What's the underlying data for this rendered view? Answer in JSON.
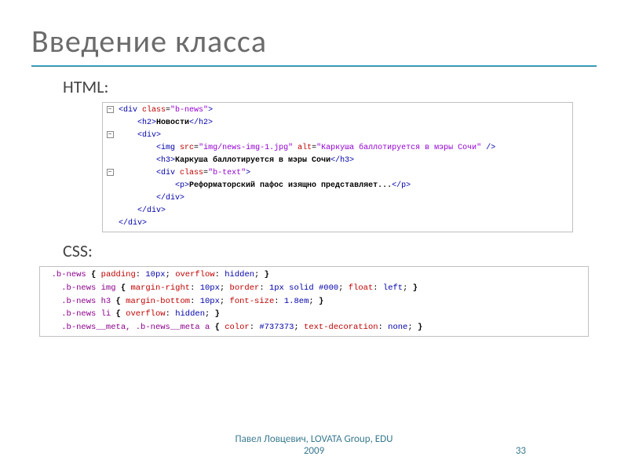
{
  "slide": {
    "title": "Введение класса",
    "section_html": "HTML:",
    "section_css": "CSS:",
    "footer_author": "Павел Ловцевич, LOVATA Group, EDU",
    "footer_year": "2009",
    "page_number": "33"
  },
  "html_code": {
    "l1_open": "<div ",
    "l1_attr": "class",
    "l1_eq": "=",
    "l1_val": "\"b-news\"",
    "l1_close": ">",
    "l2_open": "<h2>",
    "l2_text": "Новости",
    "l2_close": "</h2>",
    "l3": "<div>",
    "l4_open": "<img ",
    "l4_a1": "src",
    "l4_v1": "\"img/news-img-1.jpg\"",
    "l4_a2": "alt",
    "l4_v2": "\"Каркуша баллотируется в мэры Сочи\"",
    "l4_close": " />",
    "l5_open": "<h3>",
    "l5_text": "Каркуша баллотируется в мэры Сочи",
    "l5_close": "</h3>",
    "l6_open": "<div ",
    "l6_attr": "class",
    "l6_val": "\"b-text\"",
    "l6_close": ">",
    "l7_open": "<p>",
    "l7_text": "Реформаторский пафос изящно представляет...",
    "l7_close": "</p>",
    "l8": "</div>",
    "l9": "</div>",
    "l10": "</div>"
  },
  "css_code": {
    "r1_sel": ".b-news",
    "r1_rule": "{ padding: 10px; overflow: hidden; }",
    "r2_sel": ".b-news img",
    "r2_rule": "{ margin-right: 10px; border: 1px solid #000; float: left; }",
    "r3_sel": ".b-news h3",
    "r3_rule": "{ margin-bottom: 10px; font-size: 1.8em; }",
    "r4_sel": ".b-news li",
    "r4_rule": "{ overflow: hidden; }",
    "r5_sel": ".b-news__meta, .b-news__meta a",
    "r5_rule": "{ color: #737373; text-decoration: none; }"
  },
  "chart_data": {
    "type": "table",
    "title": "Введение класса",
    "html_code_lines": [
      "<div class=\"b-news\">",
      "  <h2>Новости</h2>",
      "  <div>",
      "    <img src=\"img/news-img-1.jpg\" alt=\"Каркуша баллотируется в мэры Сочи\" />",
      "    <h3>Каркуша баллотируется в мэры Сочи</h3>",
      "    <div class=\"b-text\">",
      "      <p>Реформаторский пафос изящно представляет...</p>",
      "    </div>",
      "  </div>",
      "</div>"
    ],
    "css_code_lines": [
      ".b-news { padding: 10px; overflow: hidden; }",
      "  .b-news img { margin-right: 10px; border: 1px solid #000; float: left; }",
      "  .b-news h3 { margin-bottom: 10px; font-size: 1.8em; }",
      "  .b-news li { overflow: hidden; }",
      "  .b-news__meta, .b-news__meta a { color: #737373; text-decoration: none; }"
    ]
  }
}
